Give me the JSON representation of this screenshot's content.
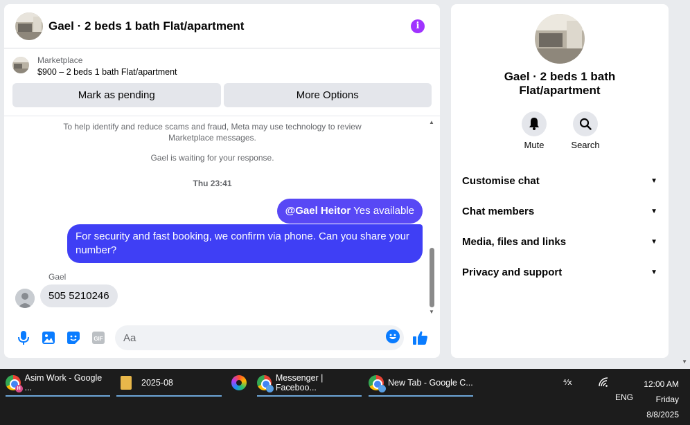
{
  "chat": {
    "title": "Gael · 2 beds 1 bath Flat/apartment",
    "listing": {
      "label": "Marketplace",
      "price_title": "$900 – 2 beds 1 bath Flat/apartment",
      "mark_pending": "Mark as pending",
      "more_options": "More Options"
    },
    "notice": "To help identify and reduce scams and fraud, Meta may use technology to review Marketplace messages.",
    "waiting": "Gael is waiting for your response.",
    "timestamp": "Thu 23:41",
    "messages": {
      "out1_mention": "@Gael Heitor",
      "out1_text": " Yes available",
      "out2_text": "For security and fast booking, we confirm via phone. Can you share your number?",
      "sender": "Gael",
      "in1_text": "505 5210246"
    },
    "composer": {
      "placeholder": "Aa"
    }
  },
  "info_panel": {
    "title": "Gael · 2 beds 1 bath Flat/apartment",
    "actions": {
      "mute": "Mute",
      "search": "Search"
    },
    "sections": [
      "Customise chat",
      "Chat members",
      "Media, files and links",
      "Privacy and support"
    ]
  },
  "taskbar": {
    "tasks": [
      "Asim Work - Google ...",
      "2025-08",
      "Messenger | Faceboo...",
      "New Tab - Google C..."
    ],
    "badge_letter": "H",
    "language": "ENG",
    "time": "12:00 AM",
    "day": "Friday",
    "date": "8/8/2025"
  },
  "colors": {
    "accent_purple": "#a033ff",
    "bubble_out": "#5848f5",
    "messenger_blue": "#0a7cff"
  }
}
